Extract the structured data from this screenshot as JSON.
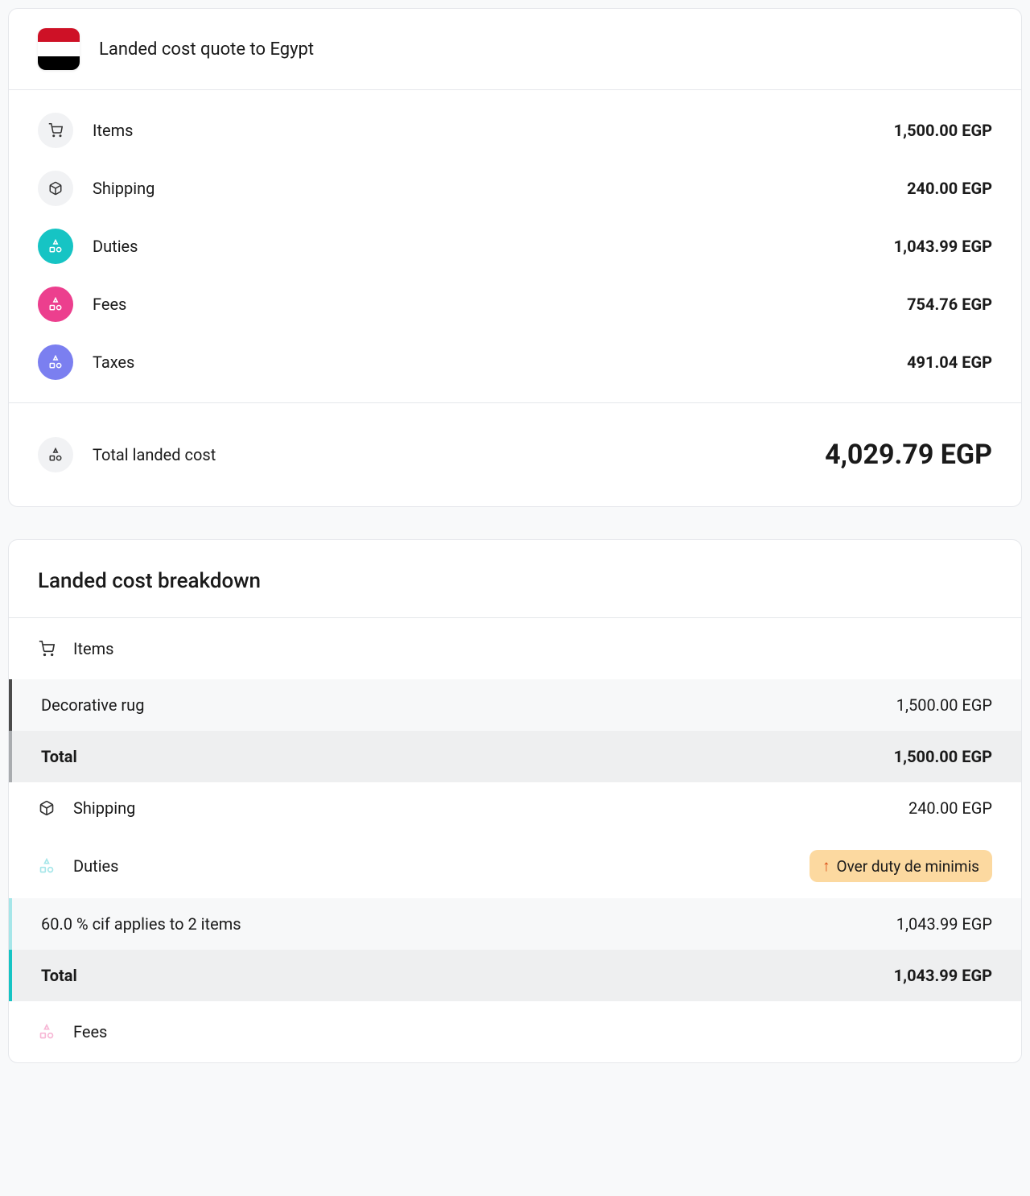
{
  "quote": {
    "title": "Landed cost quote to Egypt",
    "summary": [
      {
        "label": "Items",
        "value": "1,500.00 EGP",
        "icon": "cart-icon",
        "color": "gray"
      },
      {
        "label": "Shipping",
        "value": "240.00 EGP",
        "icon": "box-icon",
        "color": "gray"
      },
      {
        "label": "Duties",
        "value": "1,043.99 EGP",
        "icon": "shapes-icon",
        "color": "teal"
      },
      {
        "label": "Fees",
        "value": "754.76 EGP",
        "icon": "shapes-icon",
        "color": "pink"
      },
      {
        "label": "Taxes",
        "value": "491.04 EGP",
        "icon": "shapes-icon",
        "color": "purple"
      }
    ],
    "total_label": "Total landed cost",
    "total_value": "4,029.79 EGP"
  },
  "breakdown": {
    "title": "Landed cost breakdown",
    "items_label": "Items",
    "items_row_name": "Decorative rug",
    "items_row_value": "1,500.00 EGP",
    "items_total_label": "Total",
    "items_total_value": "1,500.00 EGP",
    "shipping_label": "Shipping",
    "shipping_value": "240.00 EGP",
    "duties_label": "Duties",
    "duties_badge": "Over duty de minimis",
    "duties_row_name": "60.0 % cif applies to 2 items",
    "duties_row_value": "1,043.99 EGP",
    "duties_total_label": "Total",
    "duties_total_value": "1,043.99 EGP",
    "fees_label": "Fees"
  }
}
